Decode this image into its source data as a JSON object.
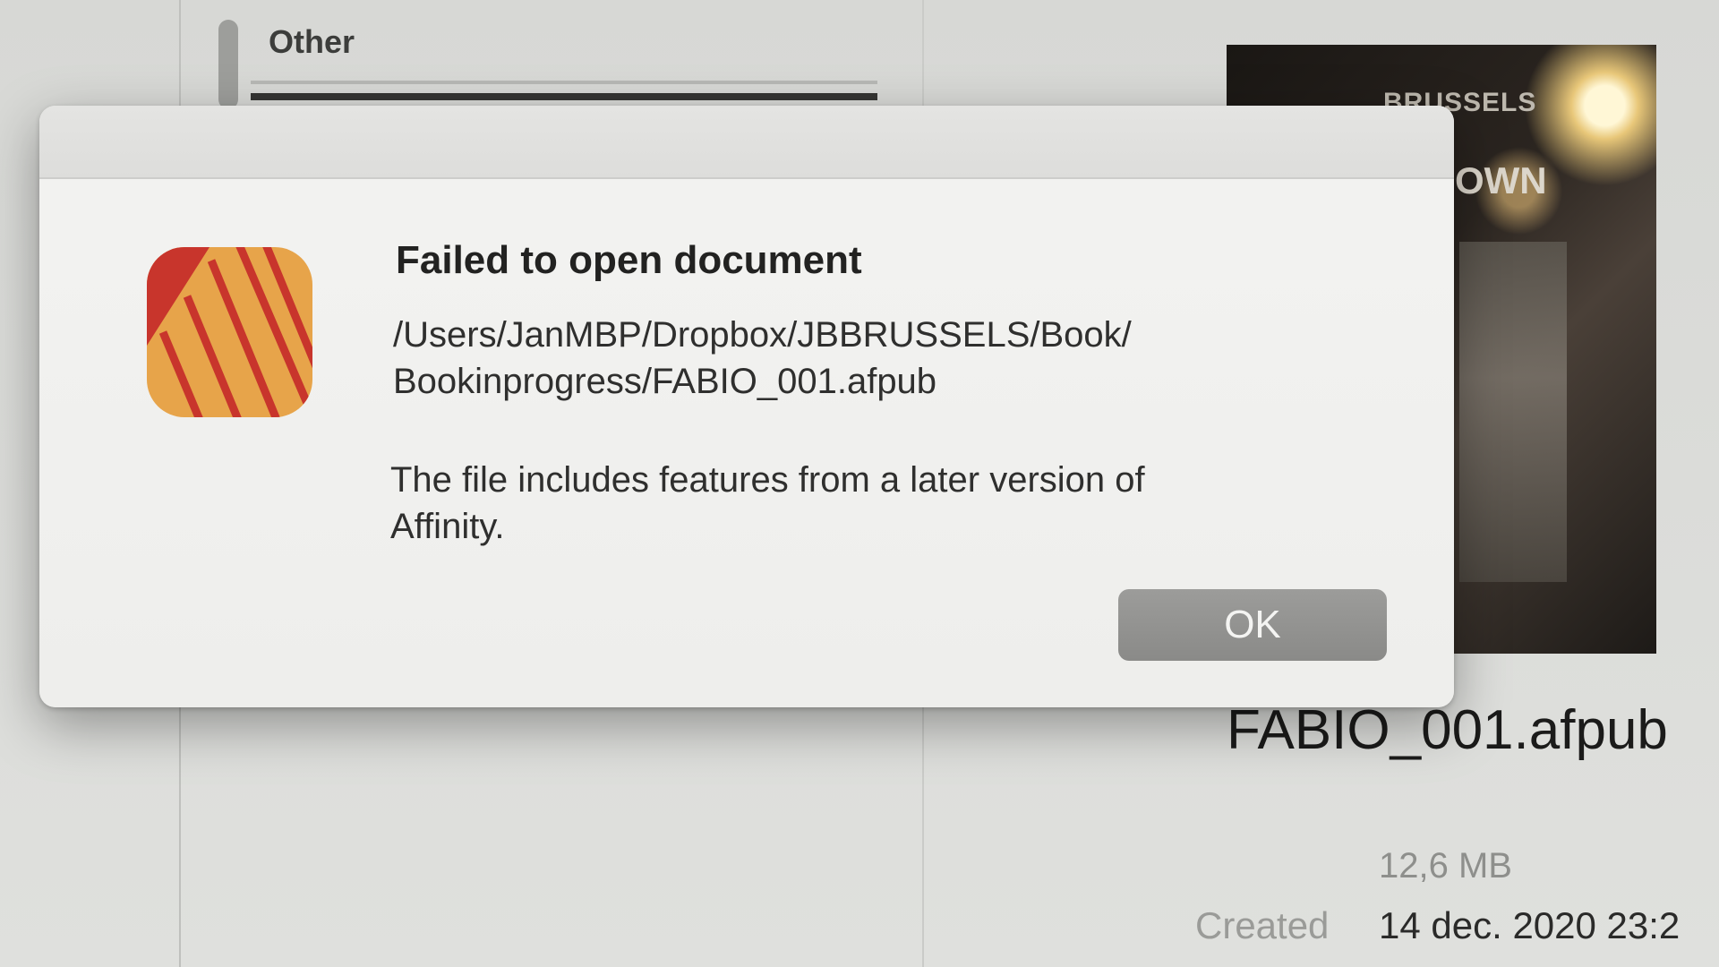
{
  "background": {
    "sidebar_header": "Other",
    "preview_text_top": "BRUSSELS",
    "preview_text_mid": "OWN",
    "file_name": "FABIO_001.afpub",
    "file_size": "12,6 MB",
    "created_label": "Created",
    "created_value": "14 dec. 2020 23:2"
  },
  "dialog": {
    "title": "Failed to open document",
    "path": "/Users/JanMBP/Dropbox/JBBRUSSELS/Book/ Bookinprogress/FABIO_001.afpub",
    "message": "The file includes features from a later version of Affinity.",
    "ok_label": "OK",
    "app_icon": "affinity-publisher-icon"
  },
  "colors": {
    "icon_orange": "#e7a44a",
    "icon_red": "#c8352c",
    "button_gray": "#8f8f8d"
  }
}
